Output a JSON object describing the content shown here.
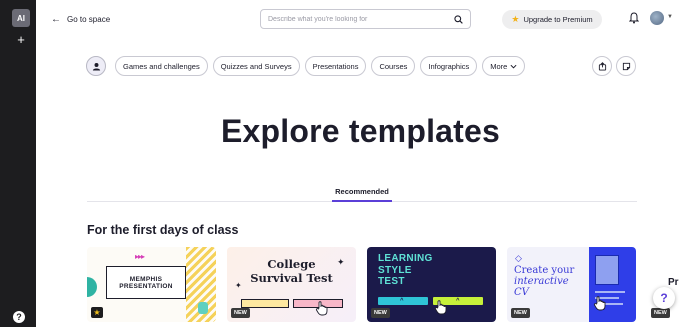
{
  "rail": {
    "logo": "AI",
    "add_icon": "+",
    "help_icon": "?"
  },
  "topbar": {
    "back_label": "Go to space",
    "search_placeholder": "Describe what you're looking for",
    "upgrade_label": "Upgrade to Premium"
  },
  "filters": {
    "chips": [
      "Games and challenges",
      "Quizzes and Surveys",
      "Presentations",
      "Courses",
      "Infographics"
    ],
    "more_label": "More"
  },
  "hero_title": "Explore templates",
  "tabs": {
    "active": "Recommended"
  },
  "section_title": "For the first days of class",
  "cards": [
    {
      "lines": [
        "MEMPHIS",
        "PRESENTATION"
      ]
    },
    {
      "lines": [
        "College",
        "Survival Test"
      ],
      "badge": "NEW"
    },
    {
      "lines": [
        "LEARNING",
        "STYLE",
        "TEST"
      ],
      "badge": "NEW"
    },
    {
      "lines": [
        "Create your",
        "interactive",
        "CV"
      ],
      "badge": "NEW"
    },
    {
      "text": "Pr",
      "badge": "NEW"
    }
  ],
  "help_fab": "?",
  "colors": {
    "accent": "#5b3fd8",
    "rail": "#1d1d1f",
    "premium_star": "#f2b21b"
  }
}
